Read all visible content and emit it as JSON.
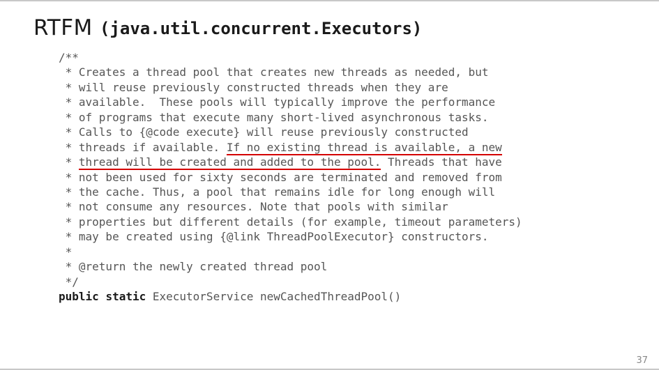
{
  "title": {
    "heading": "RTFM",
    "subheading_mono": "(java.util.concurrent.Executors)"
  },
  "javadoc": {
    "open": "/**",
    "l01": " * Creates a thread pool that creates new threads as needed, but",
    "l02": " * will reuse previously constructed threads when they are",
    "l03": " * available.  These pools will typically improve the performance",
    "l04": " * of programs that execute many short-lived asynchronous tasks.",
    "l05": " * Calls to {@code execute} will reuse previously constructed",
    "l06_pre": " * threads if available. ",
    "l06_hl": "If no existing thread is available, a new",
    "l07_pre": " * ",
    "l07_hl": "thread will be created and added to the pool.",
    "l07_post": " Threads that have",
    "l08": " * not been used for sixty seconds are terminated and removed from",
    "l09": " * the cache. Thus, a pool that remains idle for long enough will",
    "l10": " * not consume any resources. Note that pools with similar",
    "l11": " * properties but different details (for example, timeout parameters)",
    "l12": " * may be created using {@link ThreadPoolExecutor} constructors.",
    "l13": " *",
    "l14": " * @return the newly created thread pool",
    "close": " */"
  },
  "declaration": {
    "kw1": "public",
    "kw2": "static",
    "rest": " ExecutorService newCachedThreadPool()"
  },
  "page_number": "37",
  "chart_data": null
}
